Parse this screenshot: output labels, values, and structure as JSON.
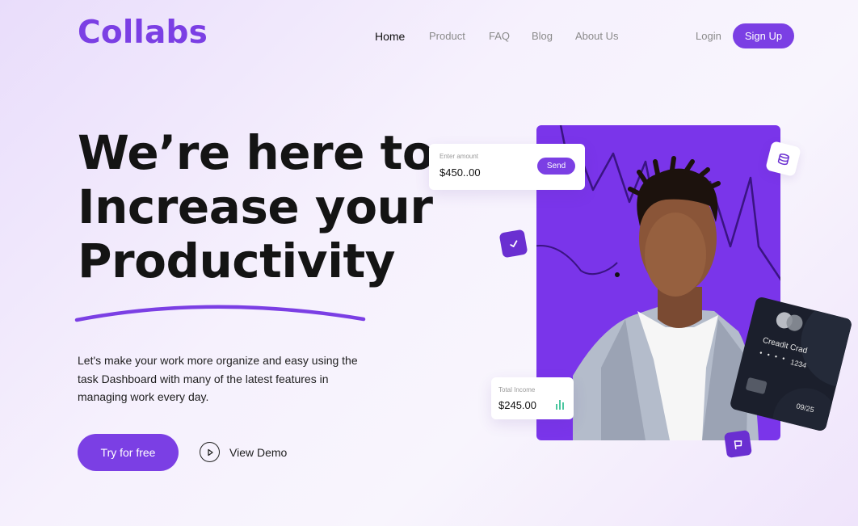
{
  "brand": {
    "logo": "Collabs"
  },
  "nav": {
    "items": [
      {
        "label": "Home",
        "active": true
      },
      {
        "label": "Product",
        "active": false
      },
      {
        "label": "FAQ",
        "active": false
      },
      {
        "label": "Blog",
        "active": false
      },
      {
        "label": "About Us",
        "active": false
      }
    ],
    "login": "Login",
    "signup": "Sign Up"
  },
  "hero": {
    "headline": [
      "We’re here to",
      "Increase your",
      "Productivity"
    ],
    "description": "Let's make your work more organize and easy using the task Dashboard with many of the latest features in managing work every day.",
    "cta_primary": "Try for free",
    "cta_secondary": "View Demo"
  },
  "widgets": {
    "amount_card": {
      "label": "Enter amount",
      "value": "$450..00",
      "button": "Send"
    },
    "income_card": {
      "label": "Total Income",
      "value": "$245.00"
    },
    "credit_card": {
      "title": "Creadit Crad",
      "dots": "• • • •",
      "number": "1234",
      "expiry": "09/25"
    }
  },
  "icons": {
    "play": "play-icon",
    "check": "check-icon",
    "database": "database-icon",
    "flag": "flag-icon",
    "bars": "bar-chart-icon"
  },
  "colors": {
    "accent": "#7b3fe4",
    "panel": "#7a35ea",
    "text": "#141414",
    "muted": "#8a8a8a",
    "card_dark": "#1b1f2c",
    "bars": "#4cc7a0"
  }
}
